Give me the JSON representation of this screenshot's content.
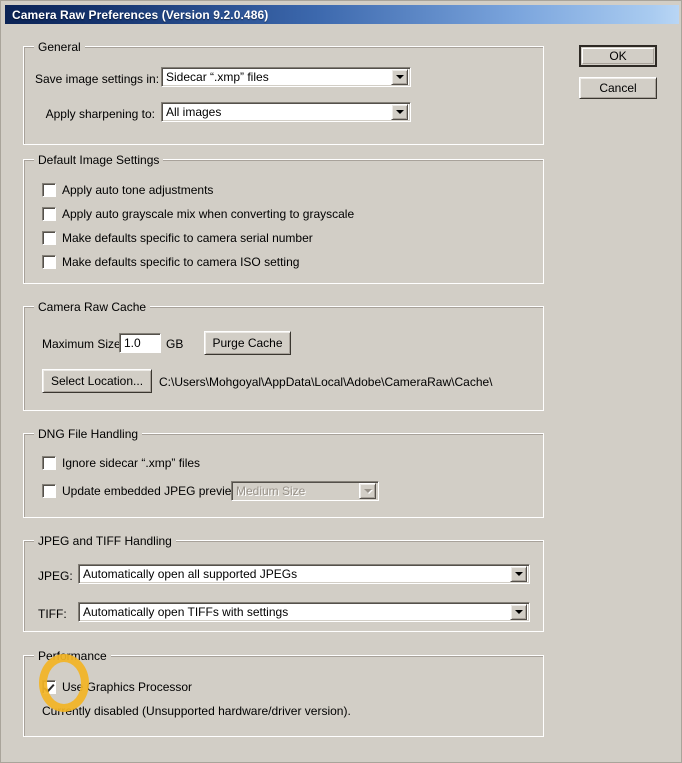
{
  "window": {
    "title": "Camera Raw Preferences  (Version 9.2.0.486)"
  },
  "buttons": {
    "ok": "OK",
    "cancel": "Cancel"
  },
  "groups": {
    "general": {
      "legend": "General",
      "save_label": "Save image settings in:",
      "save_value": "Sidecar “.xmp” files",
      "sharpen_label": "Apply sharpening to:",
      "sharpen_value": "All images"
    },
    "default_image_settings": {
      "legend": "Default Image Settings",
      "items": [
        {
          "label": "Apply auto tone adjustments",
          "checked": false
        },
        {
          "label": "Apply auto grayscale mix when converting to grayscale",
          "checked": false
        },
        {
          "label": "Make defaults specific to camera serial number",
          "checked": false
        },
        {
          "label": "Make defaults specific to camera ISO setting",
          "checked": false
        }
      ]
    },
    "camera_raw_cache": {
      "legend": "Camera Raw Cache",
      "max_size_label": "Maximum Size:",
      "max_size_value": "1.0",
      "max_size_unit": "GB",
      "purge_button": "Purge Cache",
      "select_location_button": "Select Location...",
      "cache_path": "C:\\Users\\Mohgoyal\\AppData\\Local\\Adobe\\CameraRaw\\Cache\\"
    },
    "dng_file_handling": {
      "legend": "DNG File Handling",
      "ignore_sidecar_label": "Ignore sidecar “.xmp” files",
      "ignore_sidecar_checked": false,
      "update_previews_label": "Update embedded JPEG previews:",
      "update_previews_checked": false,
      "preview_size_value": "Medium Size",
      "preview_size_disabled": true
    },
    "jpeg_tiff_handling": {
      "legend": "JPEG and TIFF Handling",
      "jpeg_label": "JPEG:",
      "jpeg_value": "Automatically open all supported JPEGs",
      "tiff_label": "TIFF:",
      "tiff_value": "Automatically open TIFFs with settings"
    },
    "performance": {
      "legend": "Performance",
      "use_gpu_label": "Use Graphics Processor",
      "use_gpu_checked": true,
      "status_text": "Currently disabled (Unsupported hardware/driver version)."
    }
  },
  "annotation": {
    "shape": "ellipse-highlight",
    "color": "#f2b424",
    "target": "use-graphics-processor-checkbox"
  }
}
